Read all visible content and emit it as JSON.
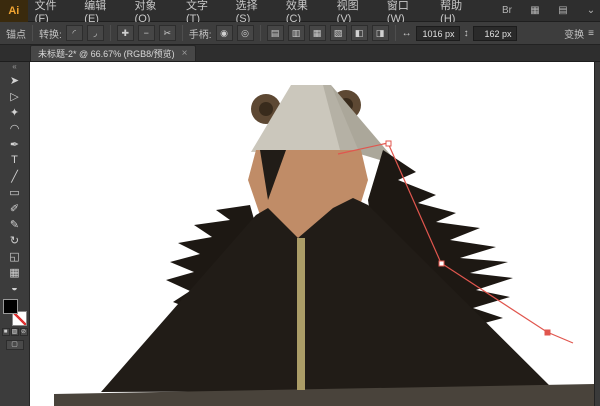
{
  "app": {
    "logo": "Ai",
    "menu": [
      "文件(F)",
      "编辑(E)",
      "对象(O)",
      "文字(T)",
      "选择(S)",
      "效果(C)",
      "视图(V)",
      "窗口(W)",
      "帮助(H)"
    ],
    "menubar_icons": [
      {
        "name": "bridge-icon",
        "glyph": "Br"
      },
      {
        "name": "arrange-documents-icon",
        "glyph": "▦"
      },
      {
        "name": "workspace-switcher-icon",
        "glyph": "▤"
      },
      {
        "name": "chevron-down-icon",
        "glyph": "⌄"
      }
    ]
  },
  "control_bar": {
    "anchor_label": "锚点",
    "convert_label": "转换:",
    "convert_buttons": [
      {
        "name": "convert-to-smooth-button",
        "glyph": "◜"
      },
      {
        "name": "convert-to-corner-button",
        "glyph": "◞"
      }
    ],
    "path_buttons": [
      {
        "name": "add-anchor-button",
        "glyph": "✚"
      },
      {
        "name": "delete-anchor-button",
        "glyph": "−"
      },
      {
        "name": "cut-path-button",
        "glyph": "✂"
      }
    ],
    "handles_label": "手柄:",
    "handle_buttons": [
      {
        "name": "show-handles-button",
        "glyph": "◉"
      },
      {
        "name": "hide-handles-button",
        "glyph": "◎"
      }
    ],
    "align_buttons": [
      {
        "name": "align-left-button",
        "glyph": "▤"
      },
      {
        "name": "align-center-button",
        "glyph": "▥"
      },
      {
        "name": "align-right-button",
        "glyph": "▦"
      },
      {
        "name": "distribute-top-button",
        "glyph": "▧"
      },
      {
        "name": "distribute-middle-button",
        "glyph": "◧"
      },
      {
        "name": "distribute-bottom-button",
        "glyph": "◨"
      }
    ],
    "x_icon": "↔",
    "x_value": "1016 px",
    "y_icon": "↕",
    "y_value": "162 px",
    "transform_label": "变换",
    "panel_menu_icon": "≡"
  },
  "document_tab": {
    "title": "未标题-2* @ 66.67% (RGB8/预览)",
    "close": "×"
  },
  "toolbar": {
    "collapse_icon": "«",
    "tools": [
      {
        "name": "selection-tool",
        "glyph": "➤"
      },
      {
        "name": "direct-selection-tool",
        "glyph": "▷"
      },
      {
        "name": "magic-wand-tool",
        "glyph": "✦"
      },
      {
        "name": "lasso-tool",
        "glyph": "◠"
      },
      {
        "name": "pen-tool",
        "glyph": "✒"
      },
      {
        "name": "type-tool",
        "glyph": "T"
      },
      {
        "name": "line-segment-tool",
        "glyph": "╱"
      },
      {
        "name": "rectangle-tool",
        "glyph": "▭"
      },
      {
        "name": "paintbrush-tool",
        "glyph": "✐"
      },
      {
        "name": "pencil-tool",
        "glyph": "✎"
      },
      {
        "name": "rotate-tool",
        "glyph": "↻"
      },
      {
        "name": "scale-tool",
        "glyph": "◱"
      },
      {
        "name": "gradient-tool",
        "glyph": "▦"
      },
      {
        "name": "eyedropper-tool",
        "glyph": "◒"
      }
    ],
    "mode_buttons": [
      {
        "name": "color-mode-button",
        "glyph": "■"
      },
      {
        "name": "gradient-mode-button",
        "glyph": "▨"
      },
      {
        "name": "none-mode-button",
        "glyph": "⊘"
      }
    ],
    "screen_mode_icon": "▢"
  },
  "canvas": {
    "artboard_color": "#ffffff",
    "colors": {
      "hood_light": "#cbc7bc",
      "hood_shade": "#b5b1a5",
      "hood_flap": "#aba79a",
      "ear_outer": "#5d4833",
      "ear_inner": "#392b1c",
      "face_tan": "#c08c67",
      "coat_dark": "#211c17",
      "fur_dark": "#1d1813",
      "center_stripe": "#ab9c67",
      "ground": "#49433b",
      "selection_path": "#e0564e"
    }
  }
}
